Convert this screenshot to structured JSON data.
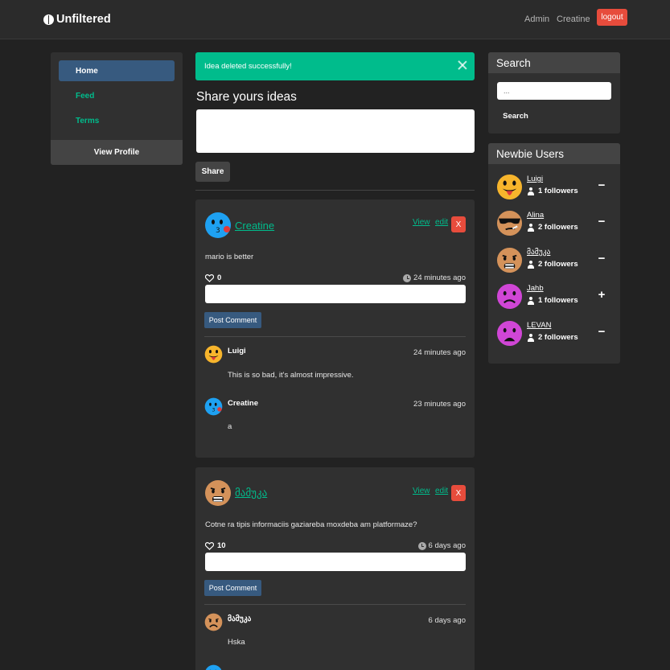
{
  "navbar": {
    "brand": "Unfiltered",
    "links": [
      "Admin",
      "Creatine"
    ],
    "logout": "logout"
  },
  "sidebar": {
    "items": [
      {
        "label": "Home",
        "active": true
      },
      {
        "label": "Feed",
        "active": false
      },
      {
        "label": "Terms",
        "active": false
      }
    ],
    "view_profile": "View Profile"
  },
  "alert": {
    "message": "Idea deleted successfully!"
  },
  "share": {
    "title": "Share yours ideas",
    "button": "Share"
  },
  "posts": [
    {
      "author": "Creatine",
      "avatar": "blue-kiss-emoji",
      "view": "View",
      "edit": "edit",
      "delete": "X",
      "text": "mario is better",
      "likes": "0",
      "time": "24 minutes ago",
      "post_comment": "Post Comment",
      "comments": [
        {
          "author": "Luigi",
          "avatar": "yellow-tongue-emoji",
          "time": "24 minutes ago",
          "text": "This is so bad, it's almost impressive."
        },
        {
          "author": "Creatine",
          "avatar": "blue-kiss-emoji",
          "time": "23 minutes ago",
          "text": "a"
        }
      ]
    },
    {
      "author": "მამუკა",
      "avatar": "tan-grimace-emoji",
      "view": "View",
      "edit": "edit",
      "delete": "X",
      "text": "Cotne ra tipis informaciis gaziareba moxdeba am platformaze?",
      "likes": "10",
      "time": "6 days ago",
      "post_comment": "Post Comment",
      "comments": [
        {
          "author": "მამუკა",
          "avatar": "tan-frown-emoji",
          "time": "6 days ago",
          "text": "Hska"
        }
      ]
    }
  ],
  "search_panel": {
    "title": "Search",
    "placeholder": "...",
    "button": "Search"
  },
  "newbie_panel": {
    "title": "Newbie Users",
    "users": [
      {
        "name": "Luigi",
        "followers": "1 followers",
        "action": "−",
        "avatar": "yellow-tongue-emoji"
      },
      {
        "name": "Alina",
        "followers": "2 followers",
        "action": "−",
        "avatar": "sunglasses-emoji"
      },
      {
        "name": "მამუკა",
        "followers": "2 followers",
        "action": "−",
        "avatar": "tan-grimace-emoji"
      },
      {
        "name": "Jahb",
        "followers": "1 followers",
        "action": "+",
        "avatar": "purple-frown-emoji"
      },
      {
        "name": "LEVAN",
        "followers": "2 followers",
        "action": "−",
        "avatar": "purple-open-frown-emoji"
      }
    ]
  },
  "colors": {
    "background": "#222222",
    "panel": "#303030",
    "accent_green": "#00bc8c",
    "primary_blue": "#375a7f",
    "danger_red": "#e74c3c"
  }
}
